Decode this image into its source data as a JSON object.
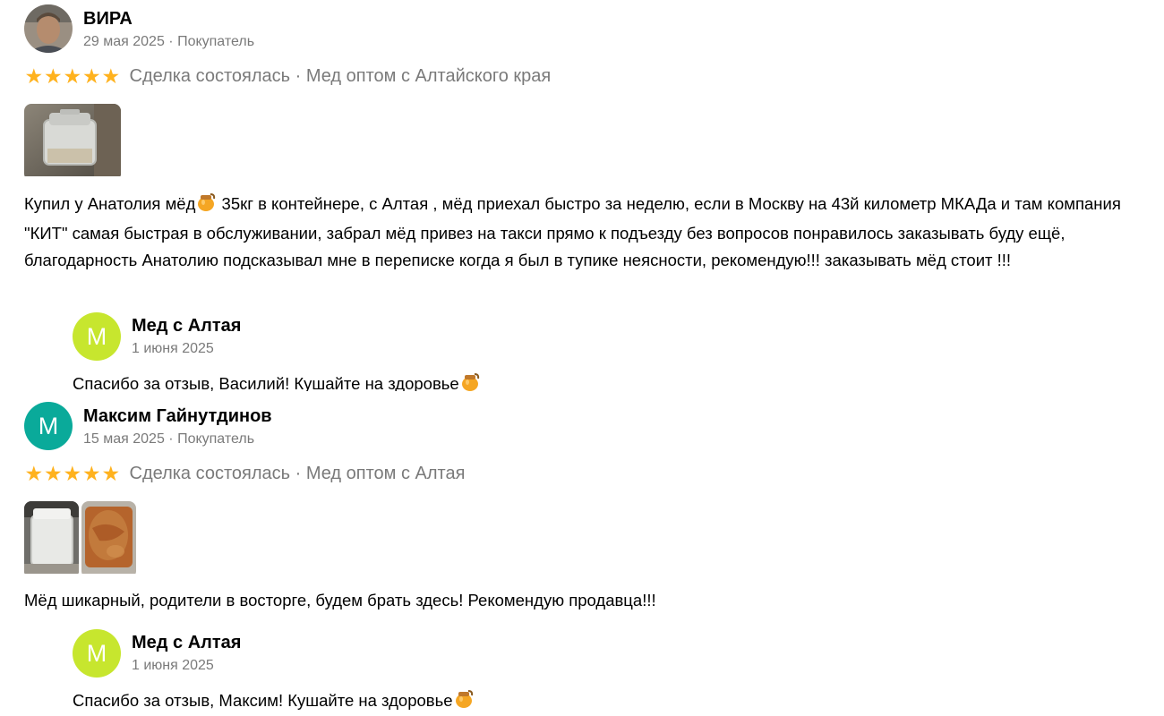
{
  "colors": {
    "star": "#ffb21e",
    "muted_text": "#7a7a7a",
    "avatar_teal": "#0aaa9a",
    "avatar_seller": "#c7e62e"
  },
  "icons": {
    "star": "star-icon",
    "honey": "honey-pot-icon"
  },
  "reviews": [
    {
      "author": "ВИРА",
      "date": "29 мая 2025",
      "role": "Покупатель",
      "date_line": "29 мая 2025 · Покупатель",
      "rating": 5,
      "deal": "Сделка состоялась · Мед оптом с Алтайского края",
      "photos_count": 1,
      "text_before_icon": "Купил у Анатолия мёд",
      "text_after_icon": " 35кг в контейнере, с Алтая , мёд приехал быстро за неделю, если в Москву на 43й километр МКАДа и там компания \"КИТ\" самая быстрая в обслуживании, забрал мёд привез на такси прямо к подъезду без вопросов понравилось заказывать буду ещё, благодарность Анатолию подсказывал мне в переписке когда я был в тупике неясности, рекомендую!!! заказывать мёд стоит !!!",
      "reply": {
        "author": "Мед с Алтая",
        "avatar_letter": "М",
        "date": "1 июня 2025",
        "text": "Спасибо за отзыв, Василий! Кушайте на здоровье"
      }
    },
    {
      "author": "Максим Гайнутдинов",
      "avatar_letter": "М",
      "date": "15 мая 2025",
      "role": "Покупатель",
      "date_line": "15 мая 2025 · Покупатель",
      "rating": 5,
      "deal": "Сделка состоялась · Мед оптом с Алтая",
      "photos_count": 2,
      "text": "Мёд шикарный, родители в восторге, будем брать здесь! Рекомендую продавца!!!",
      "reply": {
        "author": "Мед с Алтая",
        "avatar_letter": "М",
        "date": "1 июня 2025",
        "text": "Спасибо за отзыв, Максим! Кушайте на здоровье"
      }
    }
  ]
}
